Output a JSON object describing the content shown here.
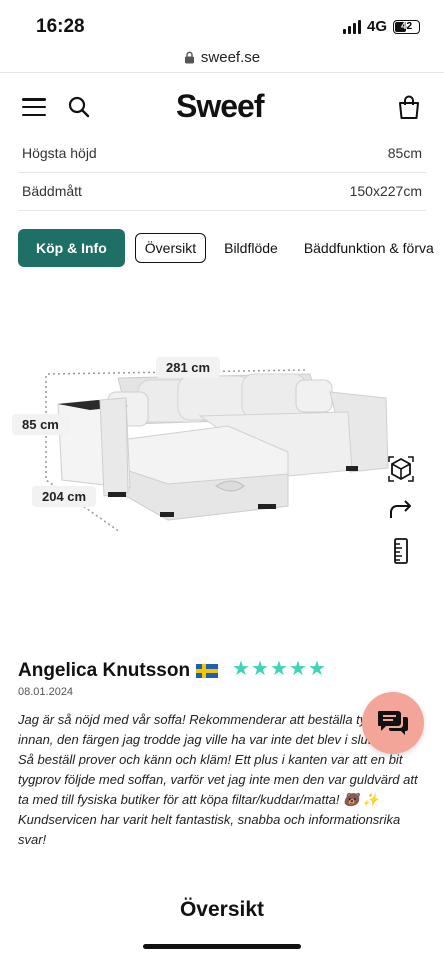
{
  "status": {
    "time": "16:28",
    "network": "4G",
    "battery": "42"
  },
  "browser": {
    "url": "sweef.se"
  },
  "nav": {
    "logo": "Sweef"
  },
  "specs": [
    {
      "label": "Högsta höjd",
      "value": "85cm"
    },
    {
      "label": "Bäddmått",
      "value": "150x227cm"
    }
  ],
  "tabs": [
    {
      "label": "Köp & Info",
      "active": true
    },
    {
      "label": "Översikt"
    },
    {
      "label": "Bildflöde"
    },
    {
      "label": "Bäddfunktion & förva"
    }
  ],
  "product": {
    "dimensions": {
      "width": "281 cm",
      "height": "85 cm",
      "depth": "204 cm"
    },
    "side_icons": [
      "ar-cube-icon",
      "share-icon",
      "ruler-icon"
    ]
  },
  "review": {
    "name": "Angelica Knutsson",
    "flag": "sweden-flag",
    "rating": 5,
    "date": "08.01.2024",
    "text": "Jag är så nöjd med vår soffa! Rekommenderar att beställa tygprover innan, den färgen jag trodde jag ville ha var inte det blev i slutändan. Så beställ prover och känn och kläm! Ett plus i kanten var att en bit tygprov följde med soffan, varför vet jag inte men den var guldvärd att ta med till fysiska butiker för att köpa filtar/kuddar/matta! 🐻 ✨ Kundservicen har varit helt fantastisk, snabba och informationsrika svar!"
  },
  "section": {
    "title": "Översikt"
  },
  "colors": {
    "accent": "#1e6f66",
    "stars": "#3fd3b8",
    "chat": "#f4a59a"
  }
}
